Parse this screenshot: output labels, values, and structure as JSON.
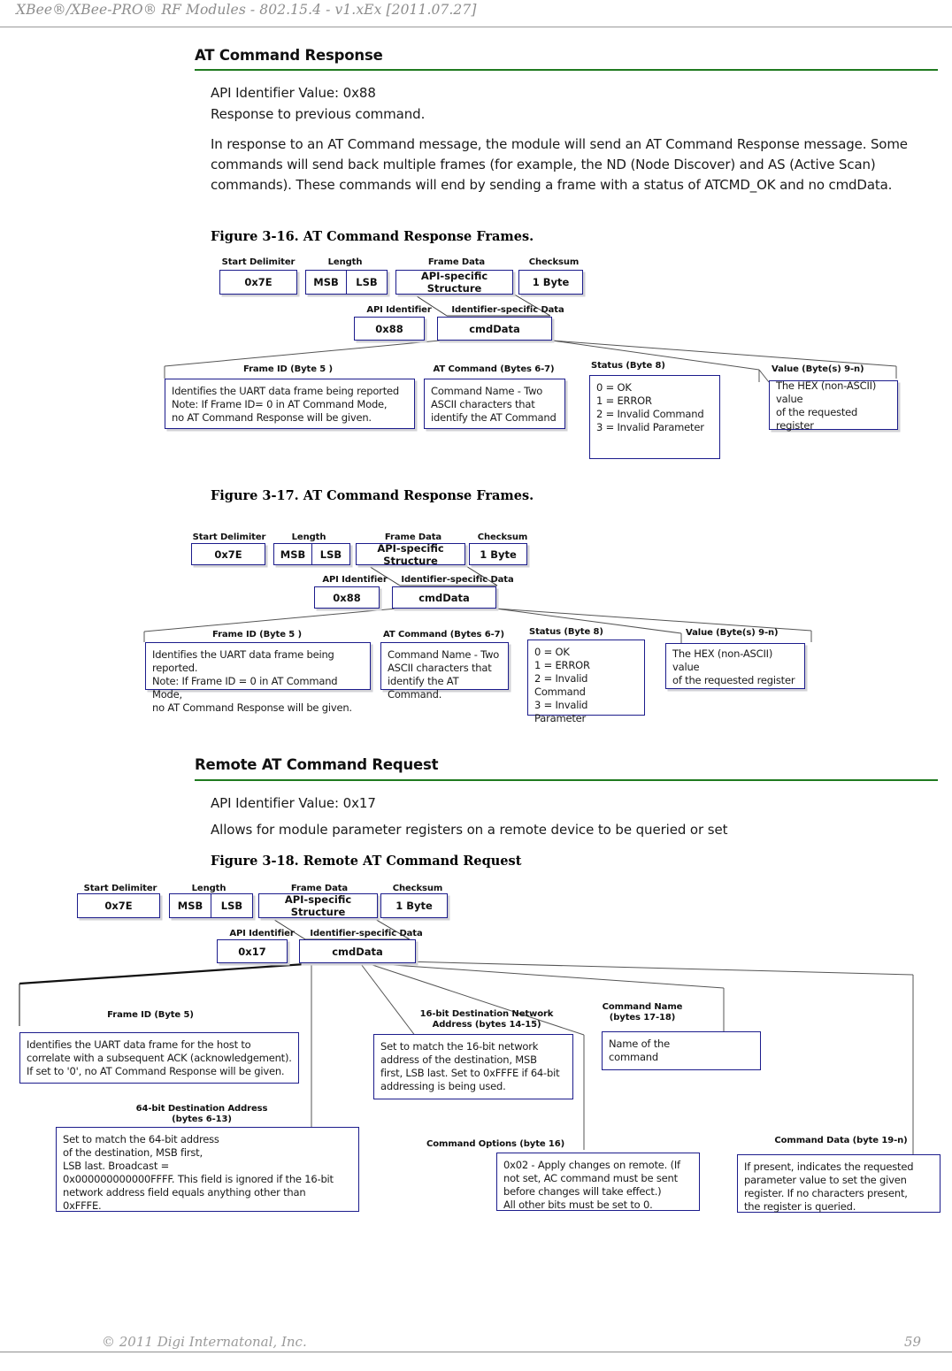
{
  "header": {
    "running_title": "XBee®/XBee-PRO®  RF Modules - 802.15.4 - v1.xEx [2011.07.27]"
  },
  "footer": {
    "copyright": "© 2011 Digi Internatonal, Inc.",
    "page_number": "59"
  },
  "sections": [
    {
      "title": "AT Command Response",
      "api_identifier_line": "API Identifier Value: 0x88",
      "subtitle_line": "Response to previous command.",
      "paragraph": "In response to an AT Command message, the module will send an AT Command Response message. Some commands will send back multiple frames (for example, the ND (Node Discover) and AS (Active Scan) commands). These commands will end by sending a frame with a status of ATCMD_OK and no cmdData."
    },
    {
      "title": "Remote AT Command Request",
      "api_identifier_line": "API Identifier Value: 0x17",
      "subtitle_line": "Allows for module parameter registers on a remote device to be queried or set"
    }
  ],
  "figures": {
    "fig316": {
      "caption": "Figure 3-16.  AT Command Response Frames.",
      "frame_labels": {
        "start_delimiter": "Start Delimiter",
        "length": "Length",
        "frame_data": "Frame Data",
        "checksum": "Checksum",
        "api_identifier": "API Identifier",
        "identifier_specific_data": "Identifier-specific Data"
      },
      "frame_values": {
        "start_delimiter": "0x7E",
        "msb": "MSB",
        "lsb": "LSB",
        "frame_data": "API-specific Structure",
        "checksum": "1 Byte",
        "api_identifier": "0x88",
        "identifier_specific_data": "cmdData"
      },
      "details": [
        {
          "label": "Frame ID  (Byte 5 )",
          "text": "Identifies the UART data frame being reported\nNote: If Frame ID= 0 in AT Command Mode,\nno AT Command Response will be given."
        },
        {
          "label": "AT Command (Bytes 6-7)",
          "text": "Command Name - Two\nASCII characters that\nidentify the AT Command"
        },
        {
          "label": "Status (Byte 8)",
          "text": "0 = OK\n1 = ERROR\n2 = Invalid Command\n3 = Invalid Parameter"
        },
        {
          "label": "Value  (Byte(s) 9-n)",
          "text": "The HEX (non-ASCII) value\nof the requested register"
        }
      ]
    },
    "fig317": {
      "caption": "Figure 3-17.  AT Command Response Frames.",
      "frame_labels": {
        "start_delimiter": "Start Delimiter",
        "length": "Length",
        "frame_data": "Frame Data",
        "checksum": "Checksum",
        "api_identifier": "API Identifier",
        "identifier_specific_data": "Identifier-specific Data"
      },
      "frame_values": {
        "start_delimiter": "0x7E",
        "msb": "MSB",
        "lsb": "LSB",
        "frame_data": "API-specific Structure",
        "checksum": "1 Byte",
        "api_identifier": "0x88",
        "identifier_specific_data": "cmdData"
      },
      "details": [
        {
          "label": "Frame ID (Byte 5 )",
          "text": "Identifies the UART data frame being reported.\nNote: If Frame ID = 0 in AT Command Mode,\nno AT Command Response will be given."
        },
        {
          "label": "AT Command (Bytes 6-7)",
          "text": "Command Name - Two\nASCII characters that\nidentify the AT Command."
        },
        {
          "label": "Status (Byte 8)",
          "text": "0 = OK\n1 = ERROR\n2 = Invalid Command\n3 = Invalid Parameter"
        },
        {
          "label": "Value (Byte(s) 9-n)",
          "text": "The HEX (non-ASCII) value\nof the requested register"
        }
      ]
    },
    "fig318": {
      "caption": "Figure 3-18.  Remote AT Command Request",
      "frame_labels": {
        "start_delimiter": "Start Delimiter",
        "length": "Length",
        "frame_data": "Frame Data",
        "checksum": "Checksum",
        "api_identifier": "API Identifier",
        "identifier_specific_data": "Identifier-specific Data"
      },
      "frame_values": {
        "start_delimiter": "0x7E",
        "msb": "MSB",
        "lsb": "LSB",
        "frame_data": "API-specific Structure",
        "checksum": "1 Byte",
        "api_identifier": "0x17",
        "identifier_specific_data": "cmdData"
      },
      "details": [
        {
          "label": "Frame ID (Byte 5)",
          "text": "Identifies the UART data frame for the host to\ncorrelate with a subsequent ACK (acknowledgement).\nIf set to '0', no AT Command Response will be given."
        },
        {
          "label": "16-bit Destination Network Address\n(bytes 14-15)",
          "text": "Set to match the 16-bit network\naddress of the destination, MSB\nfirst, LSB last. Set to 0xFFFE if 64-bit\naddressing is being used."
        },
        {
          "label": "Command Name (bytes\n17-18)",
          "text": "Name of the\ncommand"
        },
        {
          "label": "64-bit Destination Address\n(bytes 6-13)",
          "text": "Set to match the 64-bit address\nof the destination, MSB first,\nLSB last. Broadcast =\n0x000000000000FFFF. This field is ignored if the 16-bit\nnetwork address field equals anything other than\n0xFFFE."
        },
        {
          "label": "Command Options (byte 16)",
          "text": "0x02 - Apply changes on remote. (If\nnot set, AC command must be sent\nbefore changes will take effect.)\nAll other bits must be set to 0."
        },
        {
          "label": "Command Data (byte 19-n)",
          "text": "If present, indicates the requested\nparameter value to set the given\nregister. If no characters present,\nthe register is queried."
        }
      ]
    }
  },
  "colors": {
    "box_border": "#1c1c8c",
    "section_rule": "#1f7a1f",
    "header_gray": "#8d8d8d",
    "shadow": "#d2d2d6"
  }
}
